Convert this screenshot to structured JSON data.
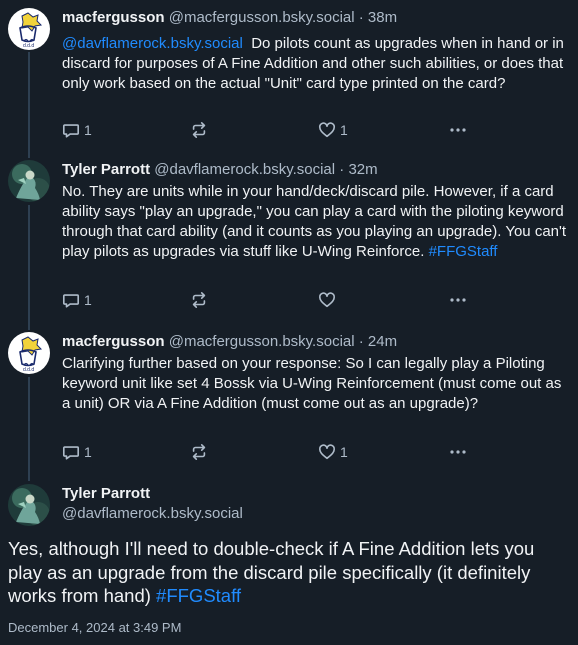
{
  "posts": [
    {
      "author_name": "macfergusson",
      "author_handle": "@macfergusson.bsky.social",
      "separator": "·",
      "time": "38m",
      "mention": "@davflamerock.bsky.social",
      "text": "Do pilots count as upgrades when in hand or in discard for purposes of A Fine Addition and other such abilities, or does that only work based on the actual \"Unit\" card type printed on the card?",
      "reply_count": "1",
      "like_count": "1"
    },
    {
      "author_name": "Tyler Parrott",
      "author_handle": "@davflamerock.bsky.social",
      "separator": "·",
      "time": "32m",
      "text": "No. They are units while in your hand/deck/discard pile. However, if a card ability says \"play an upgrade,\" you can play a card with the piloting keyword through that card ability (and it counts as you playing an upgrade). You can't play pilots as upgrades via stuff like U-Wing Reinforce.",
      "hashtag": "#FFGStaff",
      "reply_count": "1",
      "like_count": ""
    },
    {
      "author_name": "macfergusson",
      "author_handle": "@macfergusson.bsky.social",
      "separator": "·",
      "time": "24m",
      "text": "Clarifying further based on your response: So I can legally play a Piloting keyword unit like set 4 Bossk via U-Wing Reinforcement (must come out as a unit) OR via A Fine Addition (must come out as an upgrade)?",
      "reply_count": "1",
      "like_count": "1"
    }
  ],
  "main_post": {
    "author_name": "Tyler Parrott",
    "author_handle": "@davflamerock.bsky.social",
    "text": "Yes, although I'll need to double-check if A Fine Addition lets you play as an upgrade from the discard pile specifically (it definitely works from hand)",
    "hashtag": "#FFGStaff",
    "timestamp": "December 4, 2024 at 3:49 PM"
  },
  "icons": {
    "reply": "reply-bubble-icon",
    "repost": "repost-arrows-icon",
    "like": "heart-icon",
    "more": "more-dots-icon"
  },
  "colors": {
    "background": "#161e27",
    "text": "#f1f3f5",
    "muted": "#aebbc9",
    "link": "#208bfe",
    "thread_line": "#2e4052"
  }
}
